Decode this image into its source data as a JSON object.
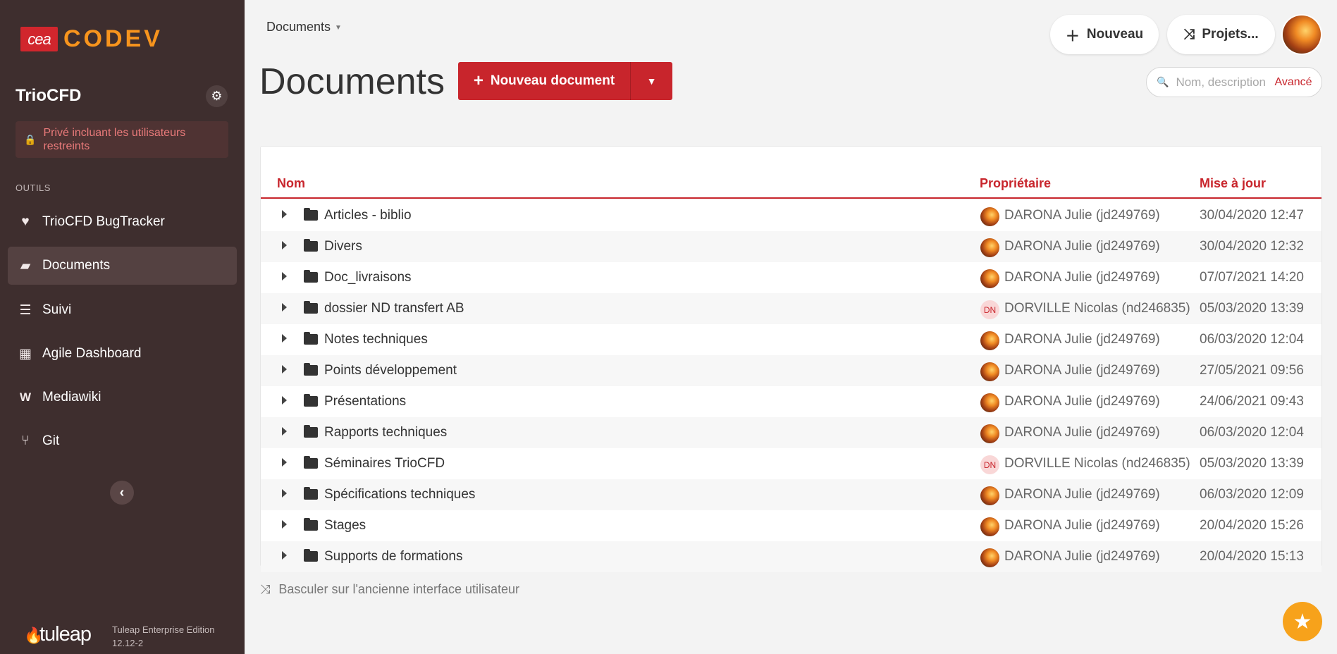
{
  "brand": {
    "cea": "cea",
    "codev": "CODEV"
  },
  "project": {
    "name": "TrioCFD",
    "privacy": "Privé incluant les utilisateurs restreints"
  },
  "sidebar": {
    "section": "OUTILS",
    "items": [
      {
        "label": "TrioCFD BugTracker",
        "icon": "heartbeat-icon"
      },
      {
        "label": "Documents",
        "icon": "folder-open-icon"
      },
      {
        "label": "Suivi",
        "icon": "list-icon"
      },
      {
        "label": "Agile Dashboard",
        "icon": "table-icon"
      },
      {
        "label": "Mediawiki",
        "icon": "mediawiki-icon"
      },
      {
        "label": "Git",
        "icon": "git-icon"
      }
    ],
    "footer": {
      "logo": "tuleap",
      "edition": "Tuleap Enterprise Edition",
      "version": "12.12-2"
    }
  },
  "header": {
    "breadcrumb": "Documents",
    "new_button": "Nouveau",
    "projects_button": "Projets..."
  },
  "main": {
    "title": "Documents",
    "new_doc_button": "Nouveau document",
    "search_placeholder": "Nom, description",
    "search_advanced": "Avancé",
    "columns": {
      "name": "Nom",
      "owner": "Propriétaire",
      "updated": "Mise à jour"
    },
    "rows": [
      {
        "name": "Articles - biblio",
        "owner": "DARONA Julie (jd249769)",
        "date": "30/04/2020 12:47",
        "avatar": "img"
      },
      {
        "name": "Divers",
        "owner": "DARONA Julie (jd249769)",
        "date": "30/04/2020 12:32",
        "avatar": "img"
      },
      {
        "name": "Doc_livraisons",
        "owner": "DARONA Julie (jd249769)",
        "date": "07/07/2021 14:20",
        "avatar": "img"
      },
      {
        "name": "dossier ND transfert AB",
        "owner": "DORVILLE Nicolas (nd246835)",
        "date": "05/03/2020 13:39",
        "avatar": "DN"
      },
      {
        "name": "Notes techniques",
        "owner": "DARONA Julie (jd249769)",
        "date": "06/03/2020 12:04",
        "avatar": "img"
      },
      {
        "name": "Points développement",
        "owner": "DARONA Julie (jd249769)",
        "date": "27/05/2021 09:56",
        "avatar": "img"
      },
      {
        "name": "Présentations",
        "owner": "DARONA Julie (jd249769)",
        "date": "24/06/2021 09:43",
        "avatar": "img"
      },
      {
        "name": "Rapports techniques",
        "owner": "DARONA Julie (jd249769)",
        "date": "06/03/2020 12:04",
        "avatar": "img"
      },
      {
        "name": "Séminaires TrioCFD",
        "owner": "DORVILLE Nicolas (nd246835)",
        "date": "05/03/2020 13:39",
        "avatar": "DN"
      },
      {
        "name": "Spécifications techniques",
        "owner": "DARONA Julie (jd249769)",
        "date": "06/03/2020 12:09",
        "avatar": "img"
      },
      {
        "name": "Stages",
        "owner": "DARONA Julie (jd249769)",
        "date": "20/04/2020 15:26",
        "avatar": "img"
      },
      {
        "name": "Supports de formations",
        "owner": "DARONA Julie (jd249769)",
        "date": "20/04/2020 15:13",
        "avatar": "img"
      }
    ],
    "switch_ui": "Basculer sur l'ancienne interface utilisateur"
  },
  "colors": {
    "accent": "#c8252c",
    "sidebar": "#3e2e2e",
    "brand_orange": "#f7941d"
  }
}
